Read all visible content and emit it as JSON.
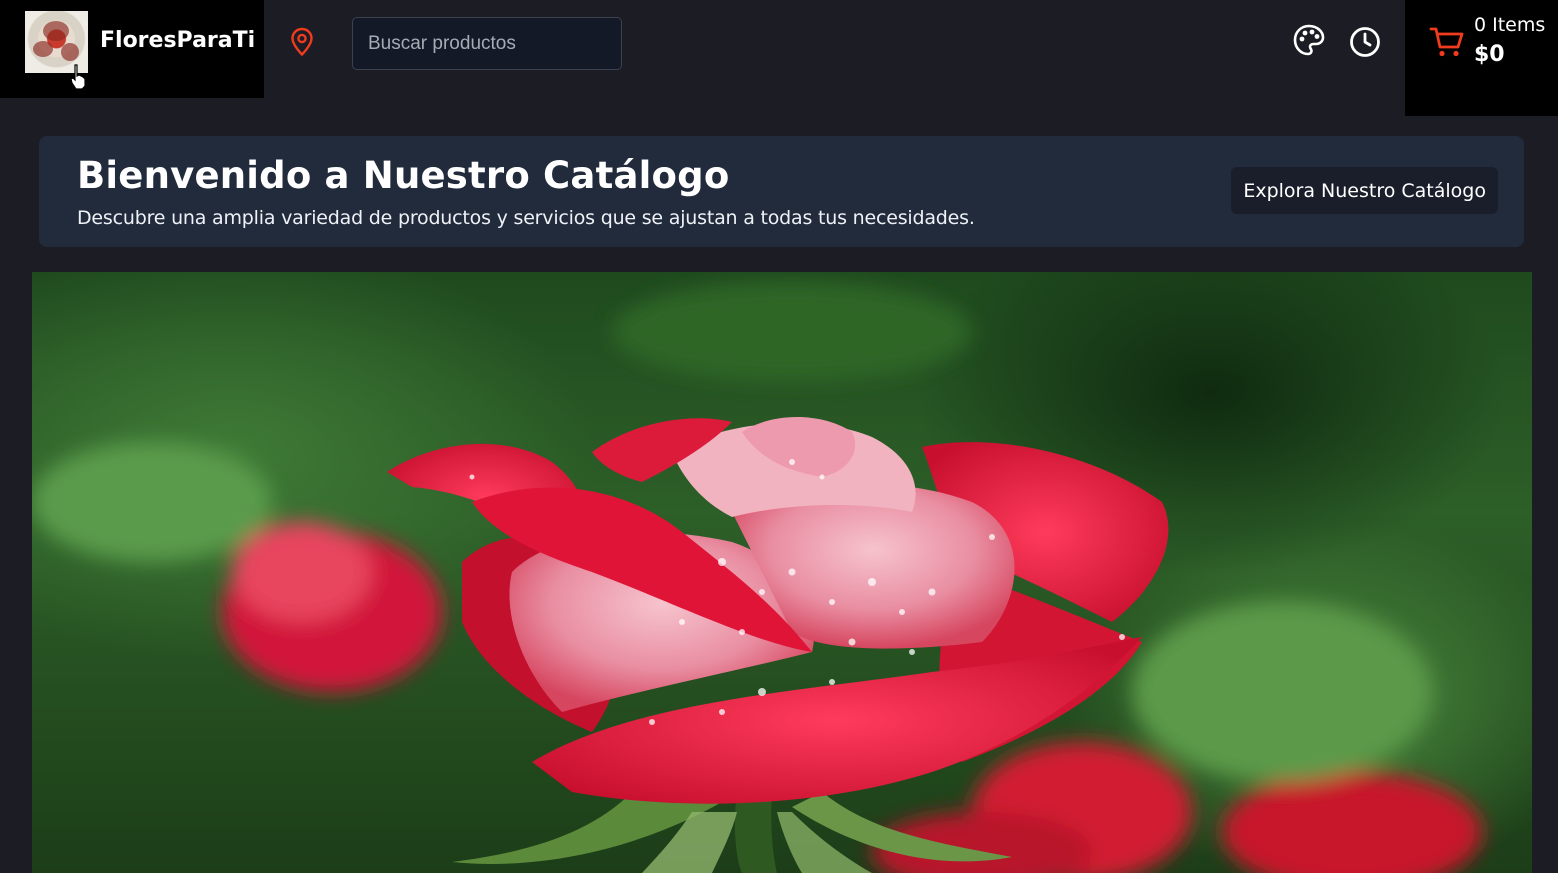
{
  "header": {
    "brand_name": "FloresParaTi",
    "logo_icon": "flower-logo",
    "location_icon": "map-pin-icon",
    "search": {
      "placeholder": "Buscar productos",
      "value": ""
    },
    "palette_icon": "palette-icon",
    "clock_icon": "clock-icon",
    "cart": {
      "icon": "cart-icon",
      "count_label": "0 Items",
      "total": "$0"
    }
  },
  "banner": {
    "title": "Bienvenido a Nuestro Catálogo",
    "subtitle": "Descubre una amplia variedad de productos y servicios que se ajustan a todas tus necesidades.",
    "button_label": "Explora Nuestro Catálogo"
  },
  "hero": {
    "image_subject": "red-pink-rose-photo"
  },
  "colors": {
    "page_background": "#1c1c24",
    "header_box": "#000000",
    "banner_background": "#222b3c",
    "accent_red": "#f03b1e"
  }
}
